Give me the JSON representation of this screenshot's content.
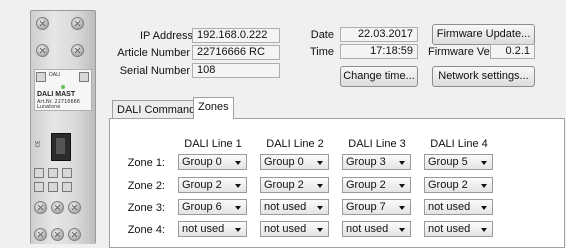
{
  "device": {
    "brand": "DALI",
    "model": "DALI MAST",
    "article_no": "Art.Nr. 22716666",
    "maker": "Lunatone",
    "ce": "CE"
  },
  "info": {
    "ip_label": "IP Address",
    "ip_value": "192.168.0.222",
    "article_label": "Article Number",
    "article_value": "22716666 RC",
    "serial_label": "Serial Number",
    "serial_value": "108",
    "date_label": "Date",
    "date_value": "22.03.2017",
    "time_label": "Time",
    "time_value": "17:18:59",
    "firmware_ver_label": "Firmware Ver",
    "firmware_ver_value": "0.2.1"
  },
  "buttons": {
    "firmware_update": "Firmware Update...",
    "change_time": "Change time...",
    "network_settings": "Network settings..."
  },
  "tabs": [
    {
      "label": "DALI Commands",
      "active": false
    },
    {
      "label": "Zones",
      "active": true
    }
  ],
  "zones": {
    "columns": [
      "DALI Line 1",
      "DALI Line 2",
      "DALI Line 3",
      "DALI Line 4"
    ],
    "rows": [
      {
        "label": "Zone 1:",
        "values": [
          "Group 0",
          "Group 0",
          "Group 3",
          "Group 5"
        ]
      },
      {
        "label": "Zone 2:",
        "values": [
          "Group 2",
          "Group 2",
          "Group 2",
          "Group 2"
        ]
      },
      {
        "label": "Zone 3:",
        "values": [
          "Group 6",
          "not used",
          "Group 7",
          "not used"
        ]
      },
      {
        "label": "Zone 4:",
        "values": [
          "not used",
          "not used",
          "not used",
          "not used"
        ]
      }
    ]
  }
}
